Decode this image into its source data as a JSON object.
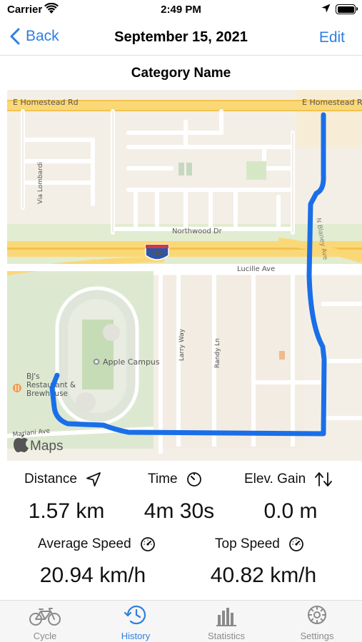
{
  "status_bar": {
    "carrier": "Carrier",
    "time": "2:49 PM"
  },
  "nav": {
    "back_label": "Back",
    "title": "September 15, 2021",
    "edit_label": "Edit"
  },
  "category_name": "Category Name",
  "map": {
    "labels": {
      "road_top_left": "E Homestead Rd",
      "road_top_right": "E Homestead Rd",
      "northwood": "Northwood Dr",
      "highway": "280",
      "lucille": "Lucille Ave",
      "via_lombardi": "Via Lombardi",
      "apple_campus": "Apple Campus",
      "larry_way": "Larry Way",
      "randy_ln": "Randy Ln",
      "restaurant_line1": "BJ's",
      "restaurant_line2": "Restaurant &",
      "restaurant_line3": "Brewhouse",
      "mariani": "Mariani Ave",
      "maps_logo": "Maps"
    },
    "route_color": "#1a6fe8"
  },
  "stats": {
    "distance": {
      "label": "Distance",
      "value": "1.57 km",
      "icon": "location-arrow-icon"
    },
    "time": {
      "label": "Time",
      "value": "4m 30s",
      "icon": "timer-icon"
    },
    "elevation": {
      "label": "Elev. Gain",
      "value": "0.0 m",
      "icon": "up-down-arrows-icon"
    },
    "average_speed": {
      "label": "Average Speed",
      "value": "20.94 km/h",
      "icon": "speedometer-icon"
    },
    "top_speed": {
      "label": "Top Speed",
      "value": "40.82 km/h",
      "icon": "speedometer-icon"
    }
  },
  "tabs": [
    {
      "label": "Cycle",
      "icon": "bicycle-icon",
      "active": false
    },
    {
      "label": "History",
      "icon": "clock-history-icon",
      "active": true
    },
    {
      "label": "Statistics",
      "icon": "bar-chart-icon",
      "active": false
    },
    {
      "label": "Settings",
      "icon": "gear-icon",
      "active": false
    }
  ],
  "colors": {
    "accent": "#2f7fde",
    "inactive": "#8a8a8a"
  }
}
